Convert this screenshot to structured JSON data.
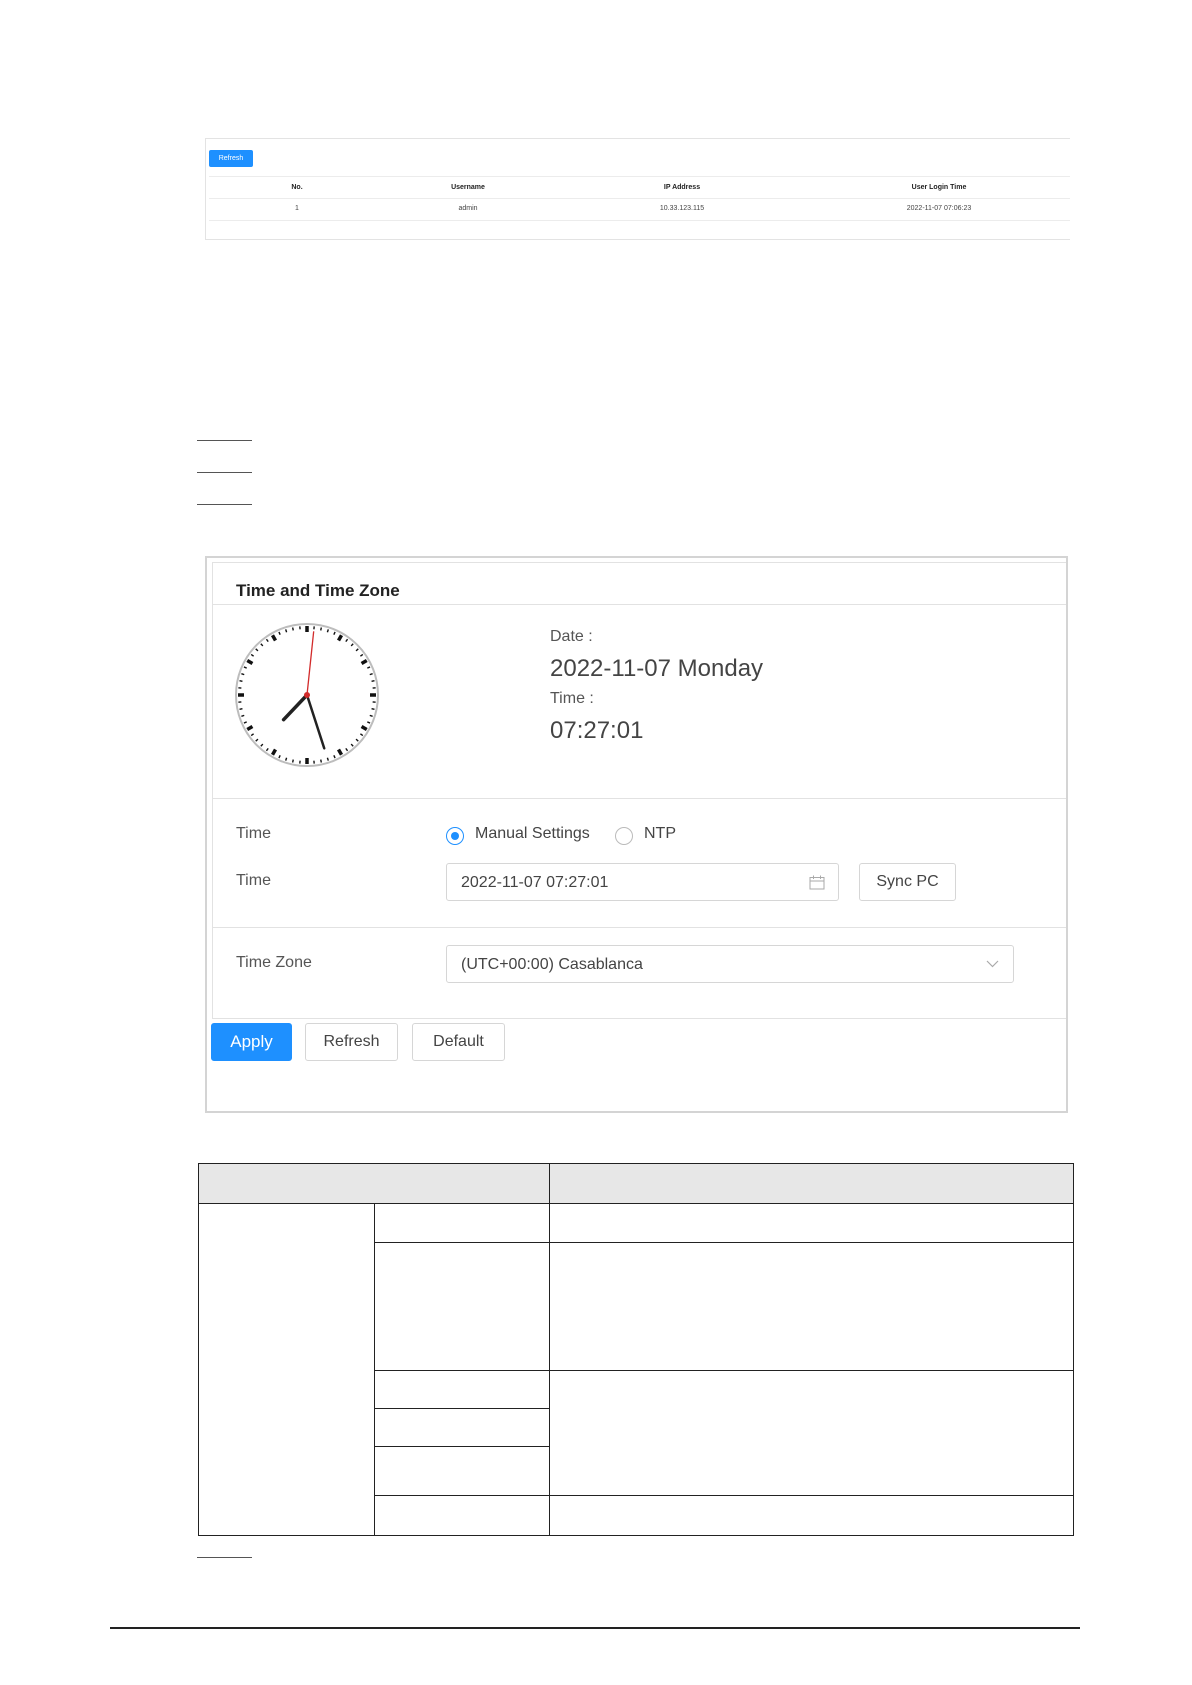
{
  "online_users": {
    "refresh_label": "Refresh",
    "columns": [
      "No.",
      "Username",
      "IP Address",
      "User Login Time"
    ],
    "rows": [
      [
        "1",
        "admin",
        "10.33.123.115",
        "2022-11-07 07:06:23"
      ]
    ]
  },
  "time_settings": {
    "title": "Time and Time Zone",
    "date_label": "Date :",
    "date_value": "2022-11-07 Monday",
    "time_label": "Time :",
    "time_value": "07:27:01",
    "clock": {
      "hour": 7,
      "minute": 27,
      "second": 1
    },
    "time_mode_label": "Time",
    "mode_options": [
      "Manual Settings",
      "NTP"
    ],
    "mode_selected": "Manual Settings",
    "system_time_label": "Time",
    "system_time_value": "2022-11-07 07:27:01",
    "sync_pc_label": "Sync PC",
    "time_zone_label": "Time Zone",
    "time_zone_value": "(UTC+00:00) Casablanca",
    "apply_label": "Apply",
    "refresh_label": "Refresh",
    "default_label": "Default"
  },
  "colors": {
    "accent": "#1e90ff",
    "second_hand": "#d22b2b"
  }
}
